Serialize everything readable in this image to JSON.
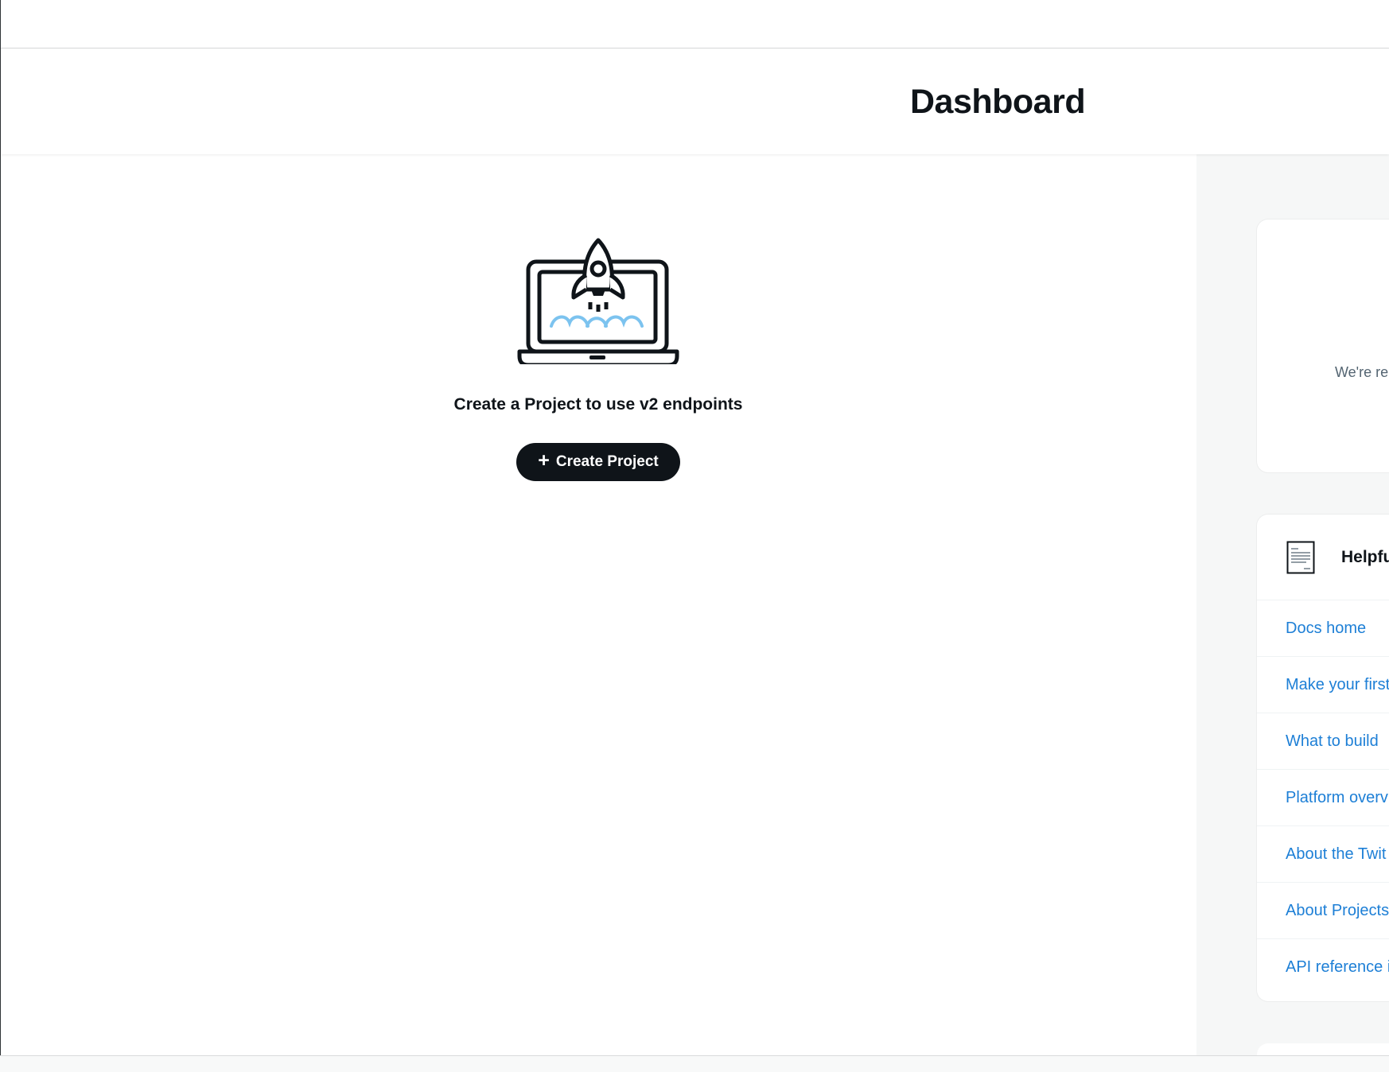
{
  "header": {
    "title": "Dashboard"
  },
  "empty_state": {
    "icon": "laptop-rocket-icon",
    "message": "Create a Project to use v2 endpoints",
    "button": {
      "icon": "plus-icon",
      "label": "Create Project"
    }
  },
  "sidebar": {
    "notice": {
      "text": "We're re"
    },
    "docs": {
      "icon": "document-icon",
      "title": "Helpfu",
      "links": [
        {
          "label": "Docs home"
        },
        {
          "label": "Make your first"
        },
        {
          "label": "What to build"
        },
        {
          "label": "Platform overv"
        },
        {
          "label": "About the Twit"
        },
        {
          "label": "About Projects"
        },
        {
          "label": "API reference i"
        }
      ]
    }
  },
  "colors": {
    "text": "#0f1419",
    "button_background": "#0f1419",
    "link": "#1d7fd6",
    "sidebar_background": "#f6f7f7",
    "illustration_accent": "#7cc3ef"
  }
}
